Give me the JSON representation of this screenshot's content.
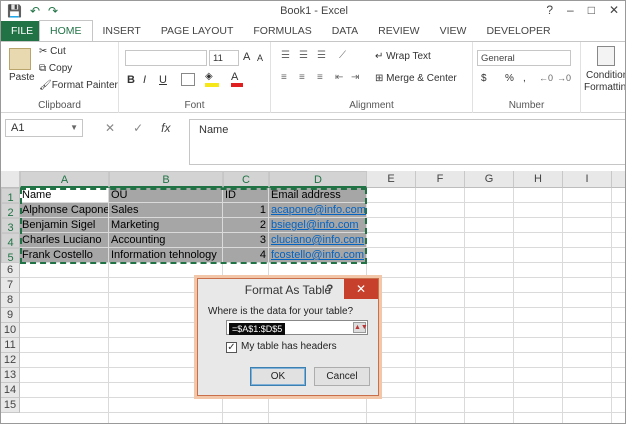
{
  "window": {
    "title": "Book1 - Excel",
    "help": "?",
    "min": "–",
    "max": "□",
    "close": "✕"
  },
  "qat": {
    "save": "💾",
    "undo": "↶",
    "redo": "↷"
  },
  "tabs": [
    "FILE",
    "HOME",
    "INSERT",
    "PAGE LAYOUT",
    "FORMULAS",
    "DATA",
    "REVIEW",
    "VIEW",
    "DEVELOPER"
  ],
  "ribbon": {
    "clipboard": {
      "label": "Clipboard",
      "paste": "Paste",
      "cut": "Cut",
      "copy": "Copy",
      "format_painter": "Format Painter"
    },
    "font": {
      "label": "Font",
      "font_name": "",
      "font_size": "11",
      "bold": "B",
      "italic": "I",
      "underline": "U",
      "grow": "A",
      "shrink": "A"
    },
    "alignment": {
      "label": "Alignment",
      "wrap": "Wrap Text",
      "merge": "Merge & Center"
    },
    "number": {
      "label": "Number",
      "format": "General",
      "currency": "$",
      "percent": "%",
      "comma": ","
    },
    "styles": {
      "conditional": "Condition",
      "formatting": "Formattin"
    }
  },
  "formula_bar": {
    "name_box": "A1",
    "fx": "fx",
    "content": "Name"
  },
  "columns": [
    "A",
    "B",
    "C",
    "D",
    "E",
    "F",
    "G",
    "H",
    "I"
  ],
  "rows": [
    "1",
    "2",
    "3",
    "4",
    "5",
    "6",
    "7",
    "8",
    "9",
    "10",
    "11",
    "12",
    "13",
    "14",
    "15"
  ],
  "table": {
    "headers": [
      "Name",
      "OU",
      "ID",
      "Email address"
    ],
    "rows": [
      [
        "Alphonse Capone",
        "Sales",
        "1",
        "acapone@info.com"
      ],
      [
        "Benjamin Sigel",
        "Marketing",
        "2",
        "bsiegel@info.com"
      ],
      [
        "Charles Luciano",
        "Accounting",
        "3",
        "cluciano@info.com"
      ],
      [
        "Frank Costello",
        "Information tehnology",
        "4",
        "fcostello@info.com"
      ]
    ]
  },
  "dialog": {
    "title": "Format As Table",
    "help": "?",
    "close": "✕",
    "question": "Where is the data for your table?",
    "range": "=$A$1:$D$5",
    "checkbox_checked": true,
    "checkbox_label": "My table has headers",
    "ok": "OK",
    "cancel": "Cancel"
  }
}
